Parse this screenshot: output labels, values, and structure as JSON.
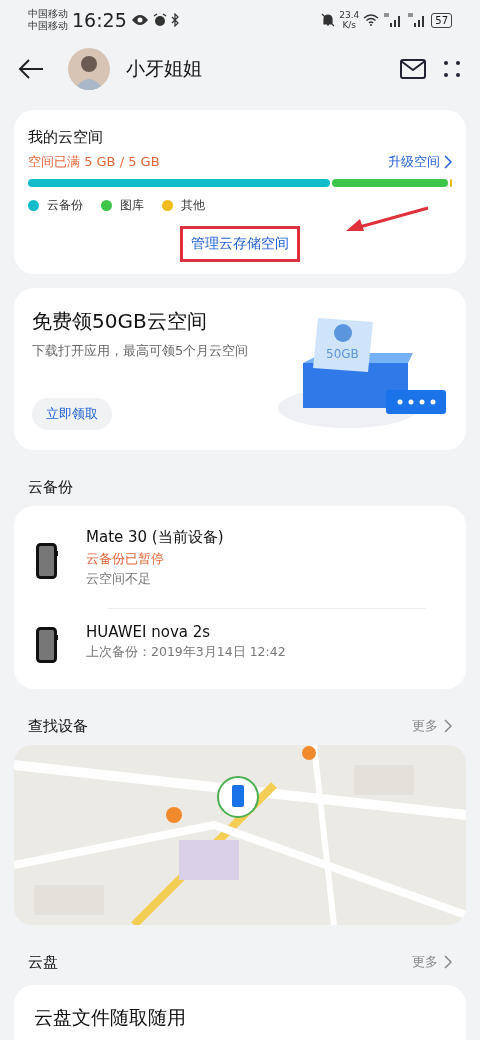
{
  "status_bar": {
    "carriers": [
      "中国移动",
      "中国移动"
    ],
    "time": "16:25",
    "speed": "23.4",
    "speed_unit": "K/s",
    "battery": "57"
  },
  "header": {
    "title": "小牙姐姐"
  },
  "storage": {
    "title": "我的云空间",
    "usage": "空间已满 5 GB / 5 GB",
    "upgrade": "升级空间",
    "manage": "管理云存储空间",
    "manage_highlighted": true,
    "segments": [
      {
        "label": "云备份",
        "color": "#12bccb"
      },
      {
        "label": "图库",
        "color": "#3ec64a"
      },
      {
        "label": "其他",
        "color": "#f2bb1c"
      }
    ]
  },
  "promo": {
    "title": "免费领50GB云空间",
    "description": "下载打开应用，最高可领5个月云空间",
    "button": "立即领取",
    "badge": "50GB"
  },
  "backup": {
    "title": "云备份",
    "devices": [
      {
        "name": "Mate 30 (当前设备)",
        "status": "云备份已暂停",
        "detail": "云空间不足"
      },
      {
        "name": "HUAWEI nova 2s",
        "detail": "上次备份：2019年3月14日 12:42"
      }
    ]
  },
  "find": {
    "title": "查找设备",
    "more": "更多"
  },
  "drive": {
    "title": "云盘",
    "more": "更多",
    "card_title": "云盘文件随取随用"
  }
}
